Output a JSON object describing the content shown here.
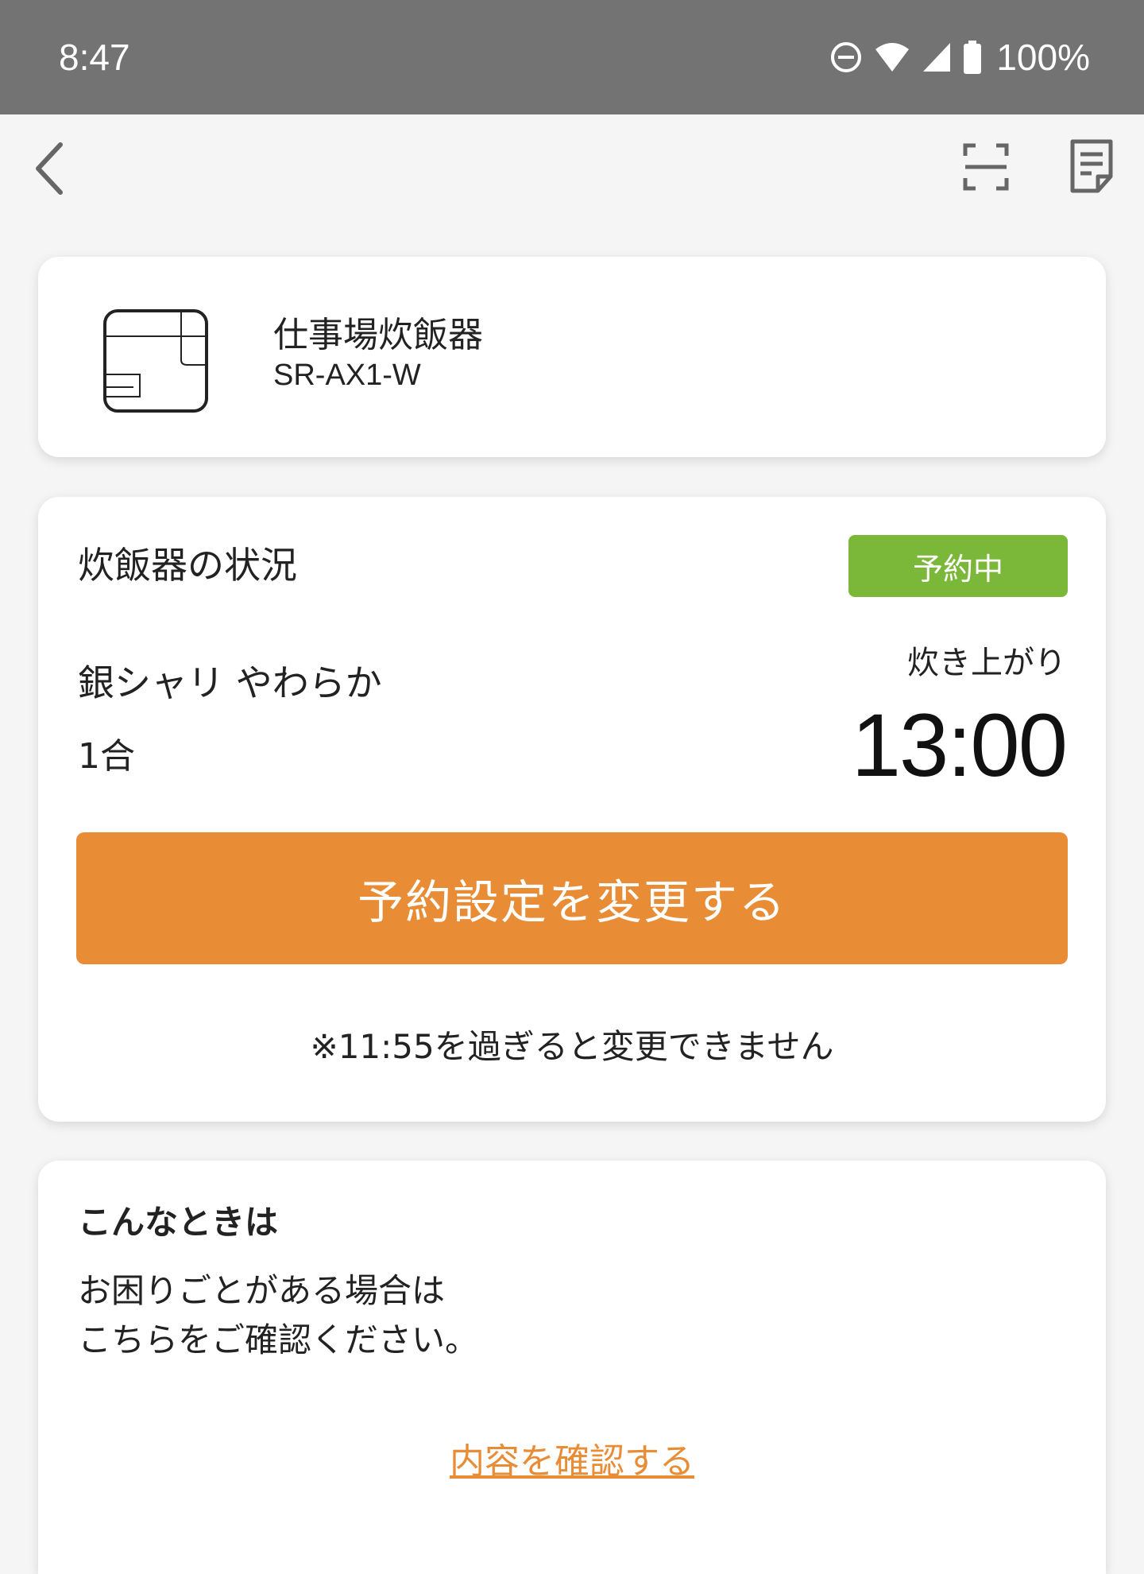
{
  "status_bar": {
    "time": "8:47",
    "battery": "100%",
    "icons": [
      "do-not-disturb-icon",
      "wifi-icon",
      "cell-signal-icon",
      "battery-icon"
    ]
  },
  "app_bar": {
    "icons": [
      "back-icon",
      "scan-icon",
      "manual-icon"
    ]
  },
  "device": {
    "name": "仕事場炊飯器",
    "model": "SR-AX1-W",
    "icon": "rice-cooker-icon"
  },
  "cooker_status": {
    "title": "炊飯器の状況",
    "badge": "予約中",
    "menu": "銀シャリ やわらか",
    "amount": "1合",
    "finish_label": "炊き上がり",
    "finish_time": "13:00",
    "change_button": "予約設定を変更する",
    "note": "※11:55を過ぎると変更できません"
  },
  "help": {
    "title": "こんなときは",
    "line1": "お困りごとがある場合は",
    "line2": "こちらをご確認ください。",
    "link": "内容を確認する"
  },
  "colors": {
    "status_bar": "#737373",
    "accent": "#e88c35",
    "badge": "#7bb83a",
    "background": "#f5f5f5"
  }
}
